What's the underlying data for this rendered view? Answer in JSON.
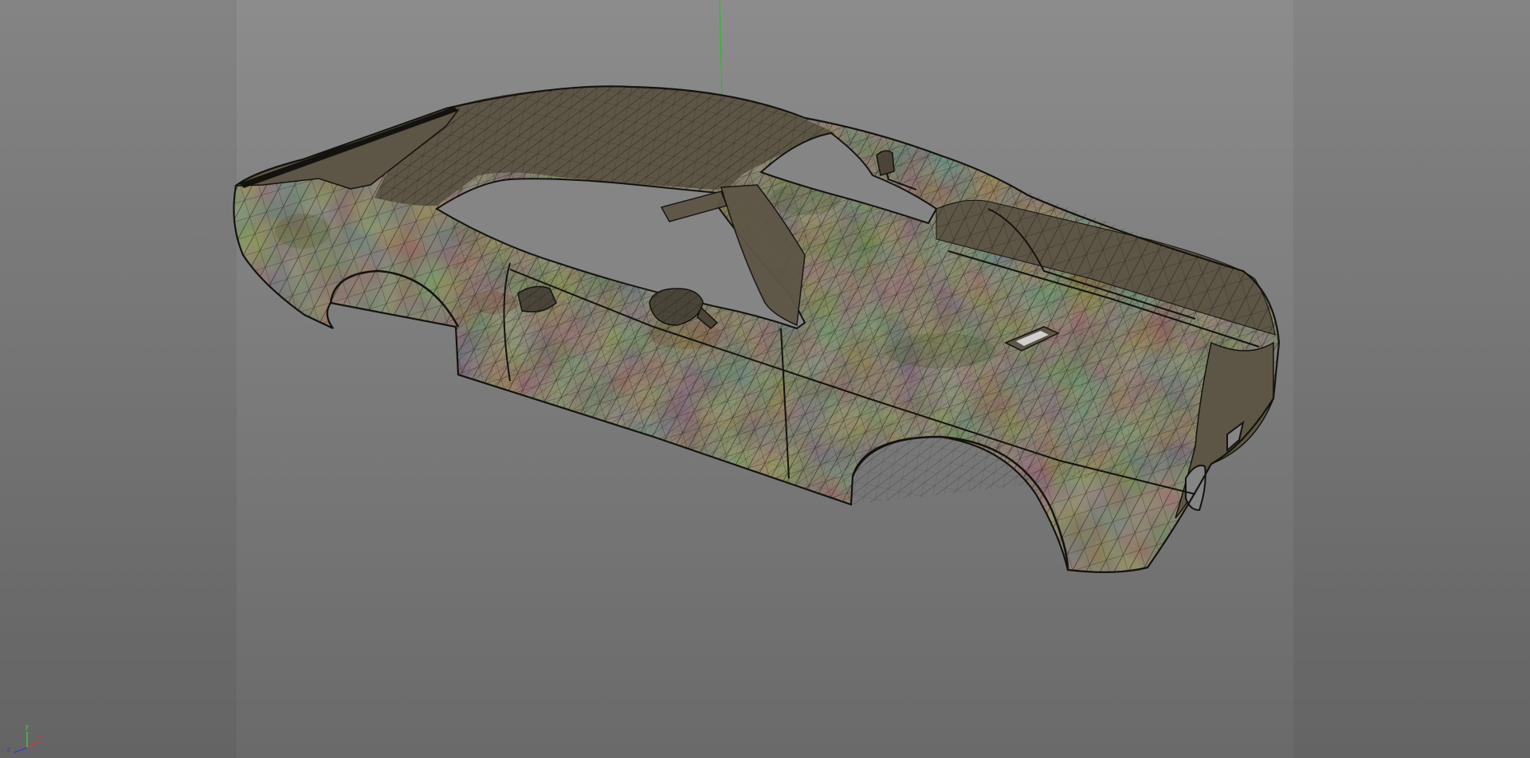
{
  "viewport": {
    "background_top": "#8c8c8c",
    "background_bottom": "#6a6a6a",
    "mode": "wireframe-on-textured",
    "object": "car-body-shell"
  },
  "axis_gizmo": {
    "x_label": "x",
    "y_label": "y",
    "z_label": "z",
    "x_color": "#d23a3a",
    "y_color": "#3ad23a",
    "z_color": "#3a3ad2"
  },
  "world_axes": {
    "x_color": "#d03838",
    "y_color": "#22c022",
    "z_color": "#3434c8"
  },
  "model_colors": {
    "fill": "#5d5646",
    "camo_green": "#59633f",
    "camo_rust": "#7a5238",
    "camo_light": "#8a8572",
    "wire": "#1f1c16",
    "edge": "#14120e"
  }
}
